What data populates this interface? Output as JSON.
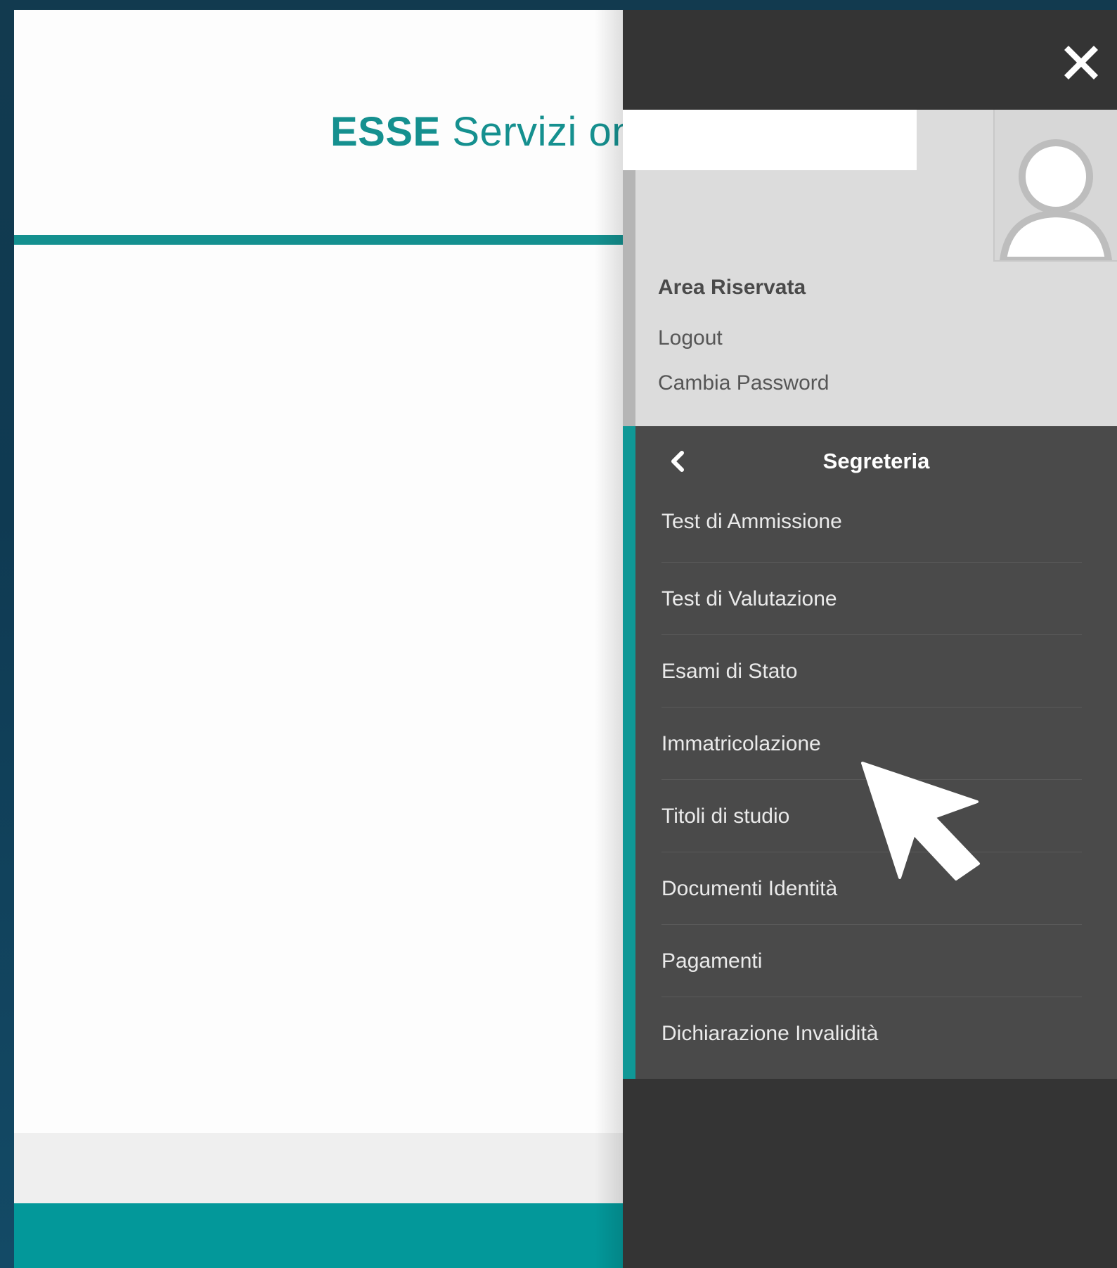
{
  "brand": {
    "bold": "ESSE",
    "rest": "Servizi on"
  },
  "colors": {
    "teal": "#14908f",
    "drawer": "#343434",
    "menu": "#4a4a4a",
    "user_panel": "#dcdcdc"
  },
  "drawer": {
    "close_icon": "close-icon",
    "user": {
      "area_title": "Area Riservata",
      "links": [
        "Logout",
        "Cambia Password"
      ],
      "avatar_icon": "user-avatar-icon"
    },
    "menu": {
      "back_icon": "chevron-left-icon",
      "title": "Segreteria",
      "items": [
        "Test di Ammissione",
        "Test di Valutazione",
        "Esami di Stato",
        "Immatricolazione",
        "Titoli di studio",
        "Documenti Identità",
        "Pagamenti",
        "Dichiarazione Invalidità"
      ]
    }
  },
  "cursor_icon": "mouse-pointer-icon"
}
